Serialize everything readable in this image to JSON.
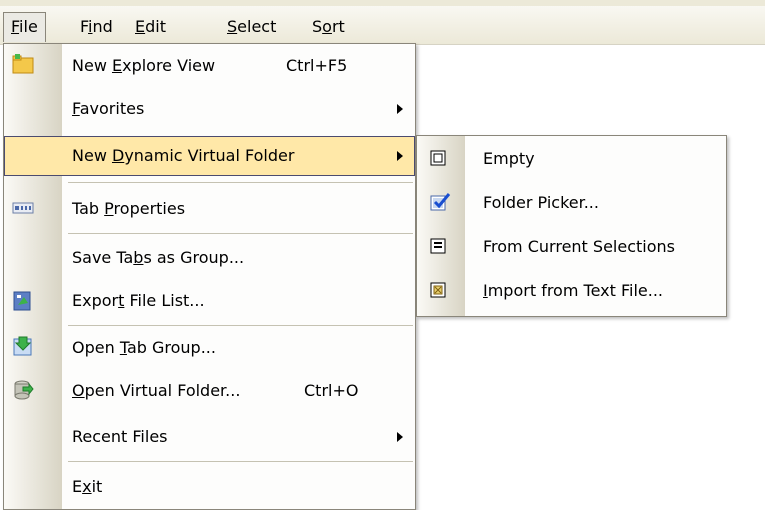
{
  "menubar": {
    "items": [
      {
        "label": "File",
        "u": "F",
        "rest": "ile"
      },
      {
        "label": "Find",
        "pre": "F",
        "u": "i",
        "rest": "nd"
      },
      {
        "label": "Edit",
        "u": "E",
        "rest": "dit"
      },
      {
        "label": "Select",
        "u": "S",
        "rest": "elect"
      },
      {
        "label": "Sort",
        "pre": "S",
        "u": "o",
        "rest": "rt"
      }
    ]
  },
  "file_menu": {
    "items": [
      {
        "pre": "New ",
        "u": "E",
        "rest": "xplore View",
        "shortcut": "Ctrl+F5",
        "icon": "new-explore-view-icon"
      },
      {
        "pre": "",
        "u": "F",
        "rest": "avorites",
        "submenu": true
      },
      {
        "pre": "New ",
        "u": "D",
        "rest": "ynamic Virtual Folder",
        "submenu": true,
        "highlighted": true
      },
      {
        "pre": "Tab ",
        "u": "P",
        "rest": "roperties",
        "icon": "tab-properties-icon"
      },
      {
        "pre": "Save Ta",
        "u": "b",
        "rest": "s as Group...",
        "shortcut": ""
      },
      {
        "pre": "Expor",
        "u": "t",
        "rest": " File List...",
        "icon": "export-file-list-icon"
      },
      {
        "pre": "Open ",
        "u": "T",
        "rest": "ab Group...",
        "icon": "open-tab-group-icon"
      },
      {
        "pre": "",
        "u": "O",
        "rest": "pen Virtual Folder...",
        "shortcut": "Ctrl+O",
        "icon": "open-virtual-folder-icon"
      },
      {
        "pre": "Recent Files",
        "u": "",
        "rest": "",
        "submenu": true
      },
      {
        "pre": "E",
        "u": "x",
        "rest": "it"
      }
    ]
  },
  "submenu": {
    "items": [
      {
        "pre": "Empty",
        "u": "",
        "rest": "",
        "icon": "empty-folder-icon"
      },
      {
        "pre": "Folder Picker...",
        "u": "",
        "rest": "",
        "icon": "folder-picker-icon"
      },
      {
        "pre": "From Current Selections",
        "u": "",
        "rest": "",
        "icon": "from-selections-icon"
      },
      {
        "pre": "",
        "u": "I",
        "rest": "mport from Text File...",
        "icon": "import-text-file-icon"
      }
    ]
  },
  "colors": {
    "highlight_fill": "#ffe8a8",
    "highlight_border": "#4b4b6f",
    "menu_bg": "#fdfdfc",
    "menubar_bg": "#ece9d8"
  }
}
